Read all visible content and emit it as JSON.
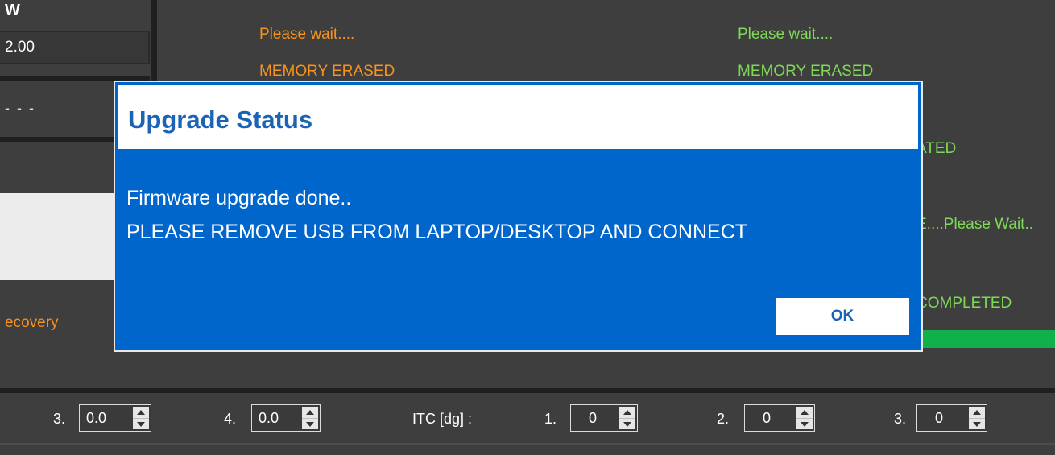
{
  "left_panel": {
    "header": "W",
    "value": "2.00",
    "dashes": "- - -",
    "recovery_label": "ecovery"
  },
  "status_left": {
    "wait": "Please wait....",
    "erased": "MEMORY ERASED"
  },
  "status_right": {
    "wait": "Please wait....",
    "erased": "MEMORY ERASED",
    "line3": "ATED",
    "line4": "E....Please Wait..",
    "line5": "COMPLETED"
  },
  "bottom": {
    "spin3_label": "3.",
    "spin3_value": "0.0",
    "spin4_label": "4.",
    "spin4_value": "0.0",
    "itc_label": "ITC [dg] :",
    "itc1_label": "1.",
    "itc1_value": "0",
    "itc2_label": "2.",
    "itc2_value": "0",
    "itc3_label": "3.",
    "itc3_value": "0"
  },
  "dialog": {
    "title": "Upgrade Status",
    "line1": "Firmware upgrade done..",
    "line2": "PLEASE REMOVE USB FROM LAPTOP/DESKTOP AND CONNECT",
    "ok_label": "OK"
  },
  "colors": {
    "background": "#3e3e3e",
    "dialog_blue": "#0066cc",
    "orange_text": "#f7931e",
    "green_text": "#7ed957",
    "progress_green": "#12b04a"
  },
  "progress": {
    "fraction": 1.0
  }
}
